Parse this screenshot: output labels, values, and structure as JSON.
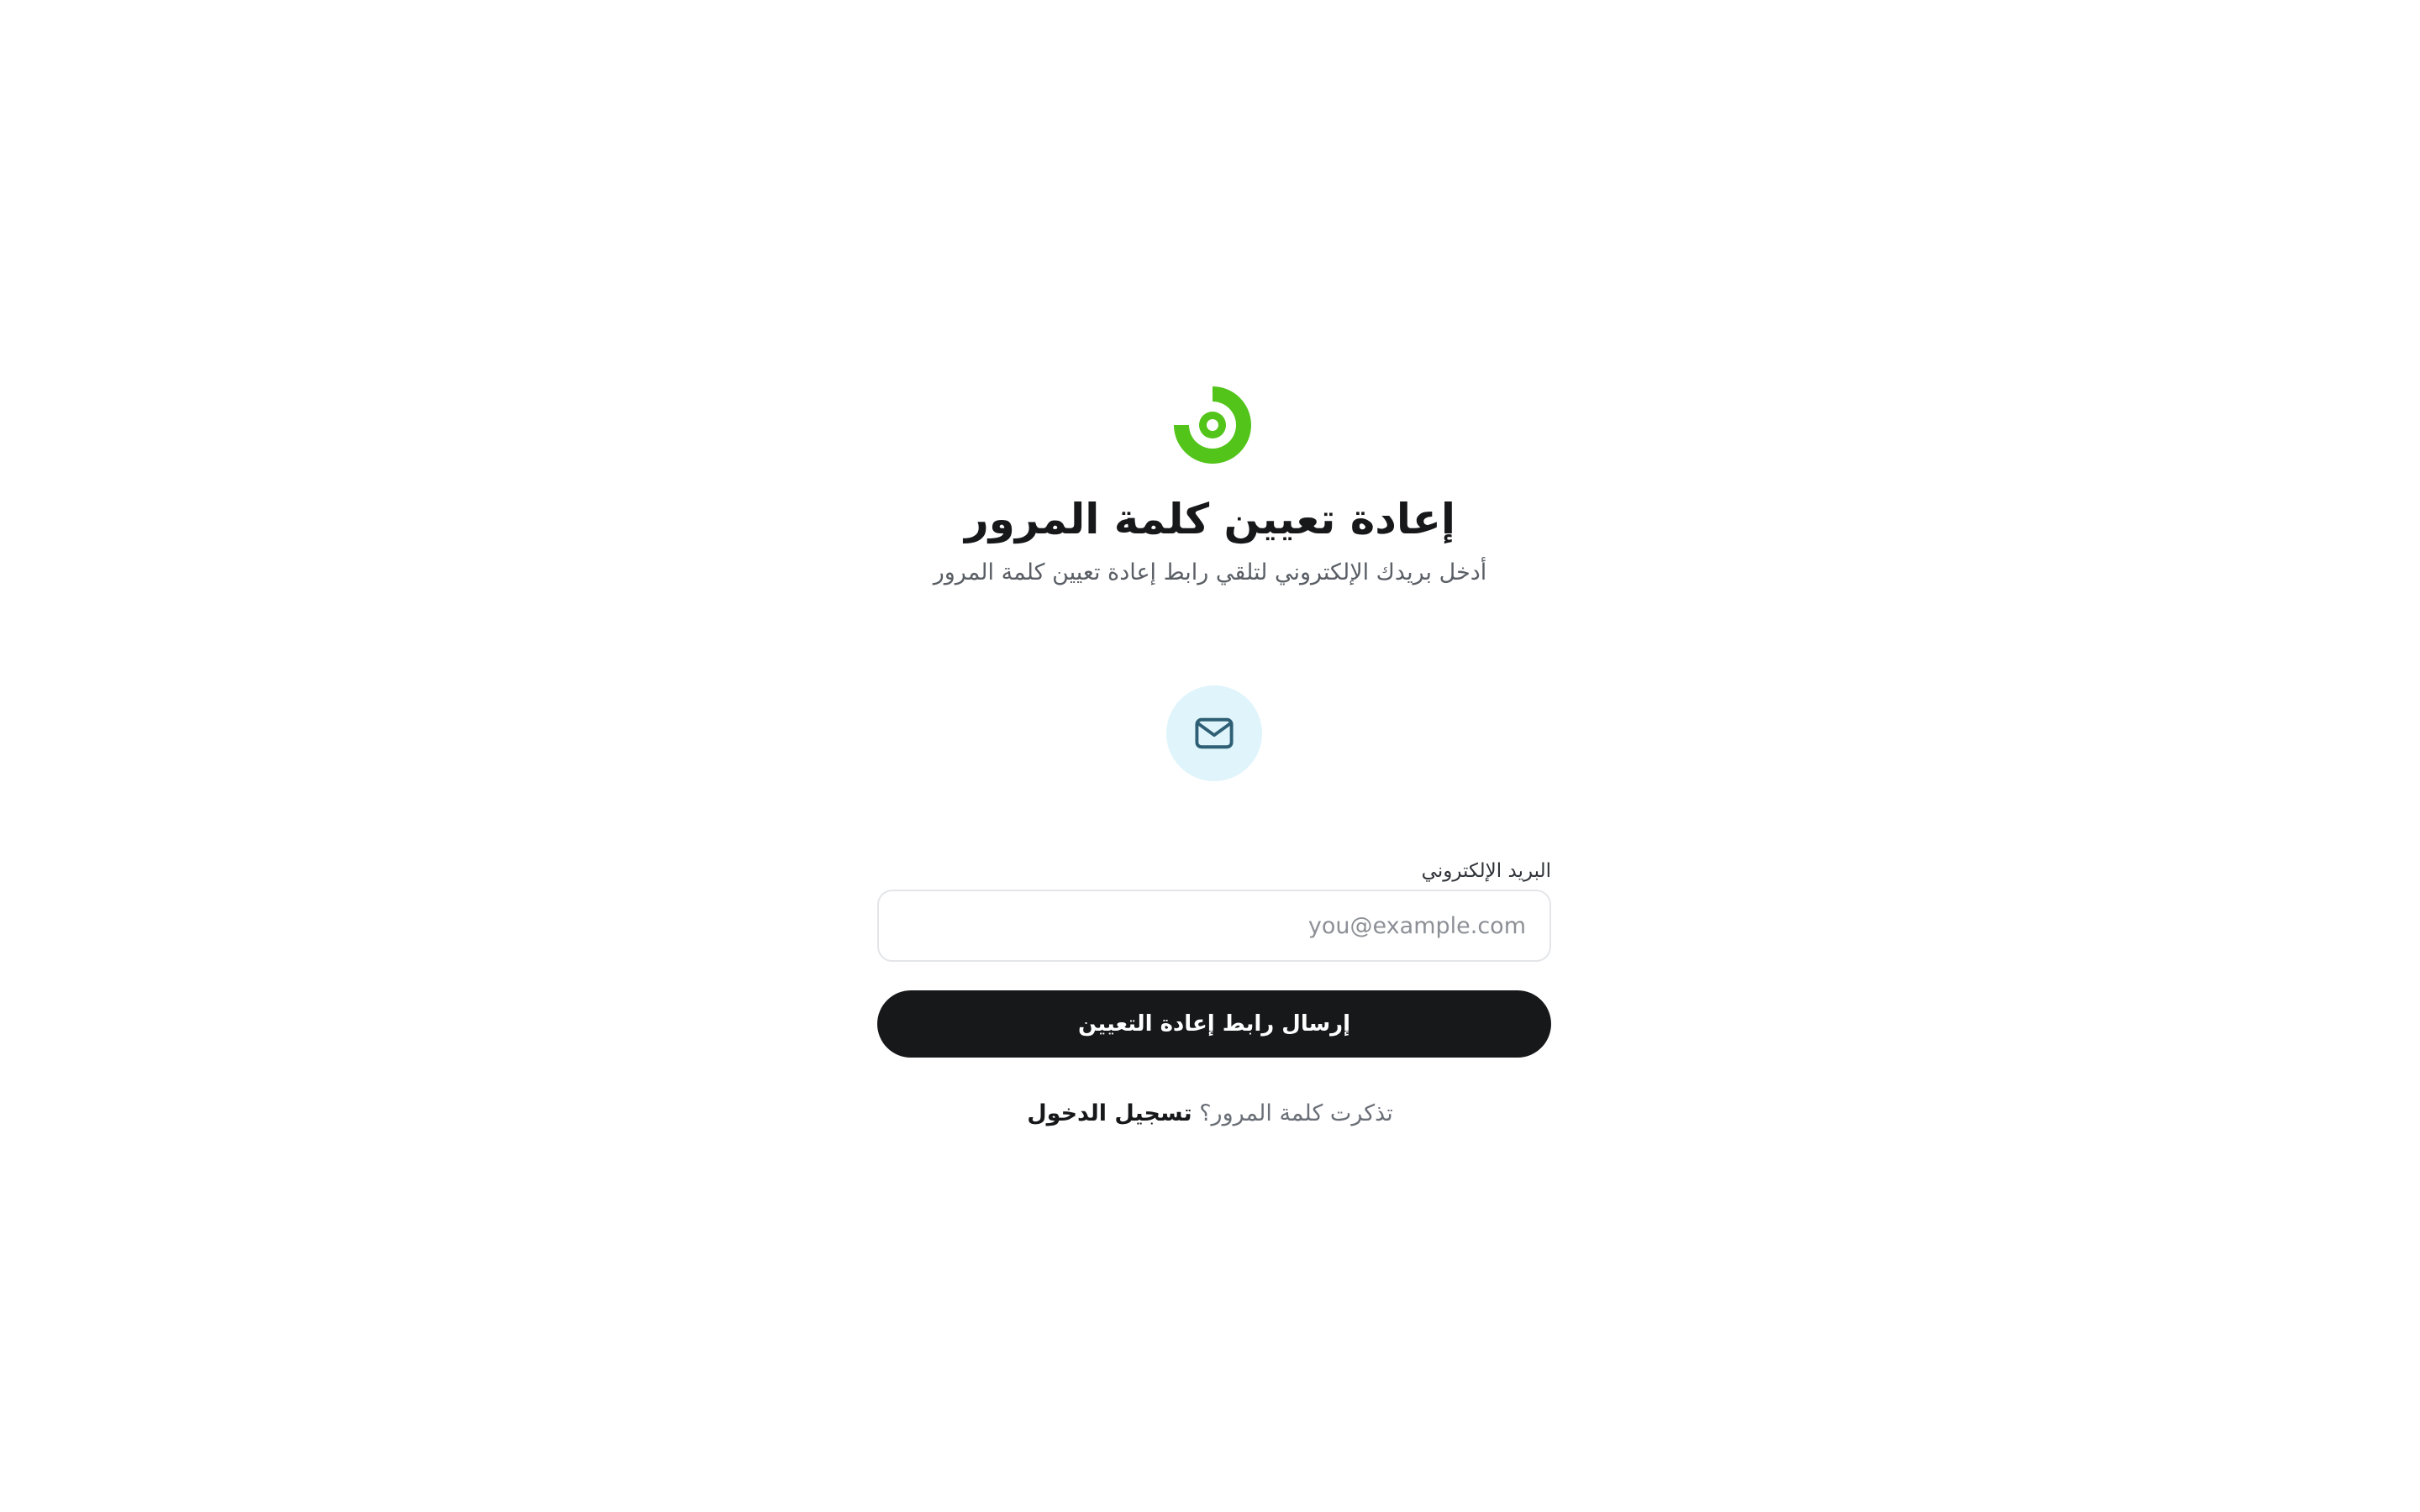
{
  "brand": {
    "logo_icon": "brand-spiral-logo-icon",
    "accent_color": "#52c41a"
  },
  "header": {
    "title": "إعادة تعيين كلمة المرور",
    "subtitle": "أدخل بريدك الإلكتروني لتلقي رابط إعادة تعيين كلمة المرور"
  },
  "illustration": {
    "icon": "mail-icon",
    "background_color": "#dff4fb",
    "icon_color": "#2e5f74"
  },
  "form": {
    "email_label": "البريد الإلكتروني",
    "email_value": "",
    "email_placeholder": "you@example.com",
    "submit_label": "إرسال رابط إعادة التعيين"
  },
  "footer": {
    "prompt": "تذكرت كلمة المرور؟",
    "login_link": "تسجيل الدخول"
  }
}
